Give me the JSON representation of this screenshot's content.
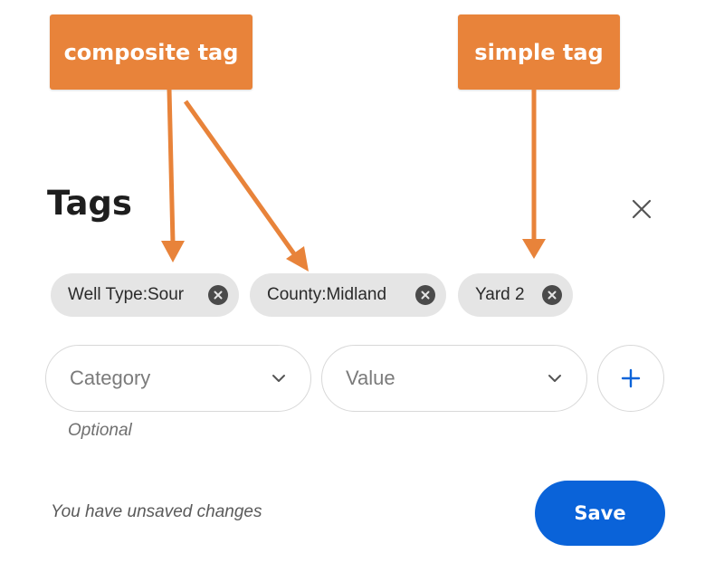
{
  "annotations": {
    "composite_label": "composite tag",
    "simple_label": "simple tag",
    "color": "#e8833a"
  },
  "panel": {
    "title": "Tags",
    "close_icon": "close-icon"
  },
  "tags": [
    {
      "label": "Well Type:Sour",
      "remove_icon": "remove-circle-icon"
    },
    {
      "label": "County:Midland",
      "remove_icon": "remove-circle-icon"
    },
    {
      "label": "Yard 2",
      "remove_icon": "remove-circle-icon"
    }
  ],
  "form": {
    "category_placeholder": "Category",
    "value_placeholder": "Value",
    "chevron_icon": "chevron-down-icon",
    "add_icon": "plus-icon",
    "hint": "Optional"
  },
  "footer": {
    "status": "You have unsaved changes",
    "save_label": "Save",
    "accent": "#0a63d9"
  }
}
